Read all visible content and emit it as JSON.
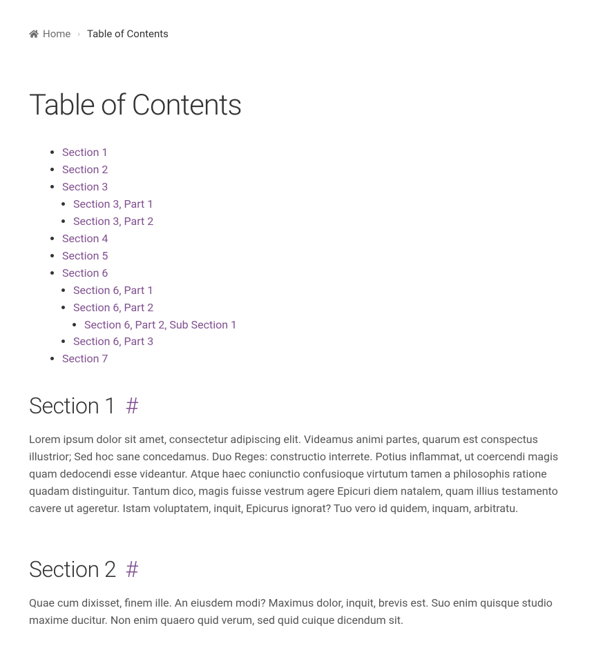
{
  "breadcrumb": {
    "home_label": "Home",
    "current_label": "Table of Contents",
    "separator": "›"
  },
  "page_title": "Table of Contents",
  "toc": [
    {
      "label": "Section 1"
    },
    {
      "label": "Section 2"
    },
    {
      "label": "Section 3",
      "children": [
        {
          "label": "Section 3, Part 1"
        },
        {
          "label": "Section 3, Part 2"
        }
      ]
    },
    {
      "label": "Section 4"
    },
    {
      "label": "Section 5"
    },
    {
      "label": "Section 6",
      "children": [
        {
          "label": "Section 6, Part 1"
        },
        {
          "label": "Section 6, Part 2",
          "children": [
            {
              "label": "Section 6, Part 2, Sub Section 1"
            }
          ]
        },
        {
          "label": "Section 6, Part 3"
        }
      ]
    },
    {
      "label": "Section 7"
    }
  ],
  "anchor_symbol": "#",
  "sections": [
    {
      "title": "Section 1",
      "body": "Lorem ipsum dolor sit amet, consectetur adipiscing elit. Videamus animi partes, quarum est conspectus illustrior; Sed hoc sane concedamus. Duo Reges: constructio interrete. Potius inflammat, ut coercendi magis quam dedocendi esse videantur. Atque haec coniunctio confusioque virtutum tamen a philosophis ratione quadam distinguitur. Tantum dico, magis fuisse vestrum agere Epicuri diem natalem, quam illius testamento cavere ut ageretur. Istam voluptatem, inquit, Epicurus ignorat? Tuo vero id quidem, inquam, arbitratu."
    },
    {
      "title": "Section 2",
      "body": "Quae cum dixisset, finem ille. An eiusdem modi? Maximus dolor, inquit, brevis est. Suo enim quisque studio maxime ducitur. Non enim quaero quid verum, sed quid cuique dicendum sit."
    }
  ]
}
